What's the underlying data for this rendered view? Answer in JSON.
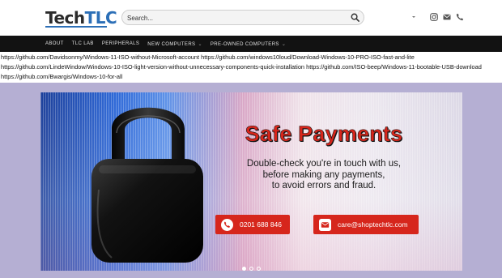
{
  "header": {
    "logo_part1": "Tech",
    "logo_part2": "TLC",
    "search_placeholder": "Search...",
    "icons": [
      "search-icon",
      "chevron-down-icon",
      "instagram-icon",
      "mail-icon",
      "phone-icon"
    ]
  },
  "nav": {
    "items": [
      {
        "label": "ABOUT"
      },
      {
        "label": "TLC LAB"
      },
      {
        "label": "PERIPHERALS"
      },
      {
        "label": "NEW COMPUTERS"
      },
      {
        "label": "PRE-OWNED COMPUTERS"
      }
    ],
    "dropdown_marker": "⌄"
  },
  "links_text": "https://github.com/Davidsonmy/Windows-11-ISO-without-Microsoft-account https://github.com/windows10loud/Download-Windows-10-PRO-ISO-fast-and-lite https://github.com/LindeWindow/Windows-10-ISO-light-version-without-unnecessary-components-quick-installation https://github.com/ISO-beep/Windows-11-bootable-USB-download https://github.com/Bwargis/Windows-10-for-all",
  "slide": {
    "headline": "Safe Payments",
    "sub_line1": "Double-check you're in touch with us,",
    "sub_line2": "before making any payments,",
    "sub_line3": "to avoid errors and fraud.",
    "phone": "0201 688 846",
    "email": "care@shoptechtlc.com",
    "accent": "#d6261c"
  },
  "colors": {
    "brand_blue": "#2c6fb7",
    "nav_bg": "#121212",
    "slider_bg": "#b5afd3"
  }
}
